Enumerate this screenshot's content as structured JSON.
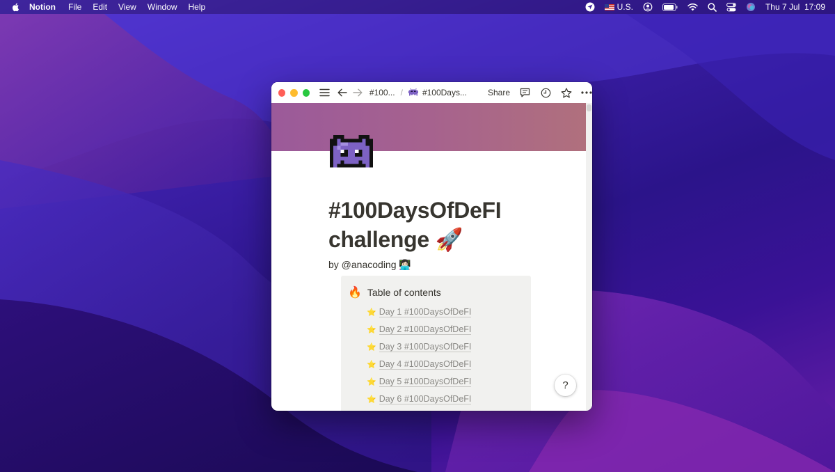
{
  "menubar": {
    "app_name": "Notion",
    "menus": [
      "File",
      "Edit",
      "View",
      "Window",
      "Help"
    ],
    "input_source": "U.S.",
    "clock": "Thu 7 Jul  17:09"
  },
  "window": {
    "breadcrumb_parent": "#100...",
    "breadcrumb_current": "#100Days...",
    "share_label": "Share"
  },
  "page": {
    "title_line1": "#100DaysOfDeFI",
    "title_line2": "challenge 🚀",
    "byline": "by @anacoding 👩🏻‍💻",
    "toc": {
      "heading": "Table of contents",
      "icon": "🔥",
      "items": [
        "Day 1 #100DaysOfDeFI",
        "Day 2 #100DaysOfDeFI",
        "Day 3 #100DaysOfDeFI",
        "Day 4 #100DaysOfDeFI",
        "Day 5 #100DaysOfDeFI",
        "Day 6 #100DaysOfDeFI"
      ],
      "item_icon": "⭐"
    }
  },
  "help_label": "?"
}
